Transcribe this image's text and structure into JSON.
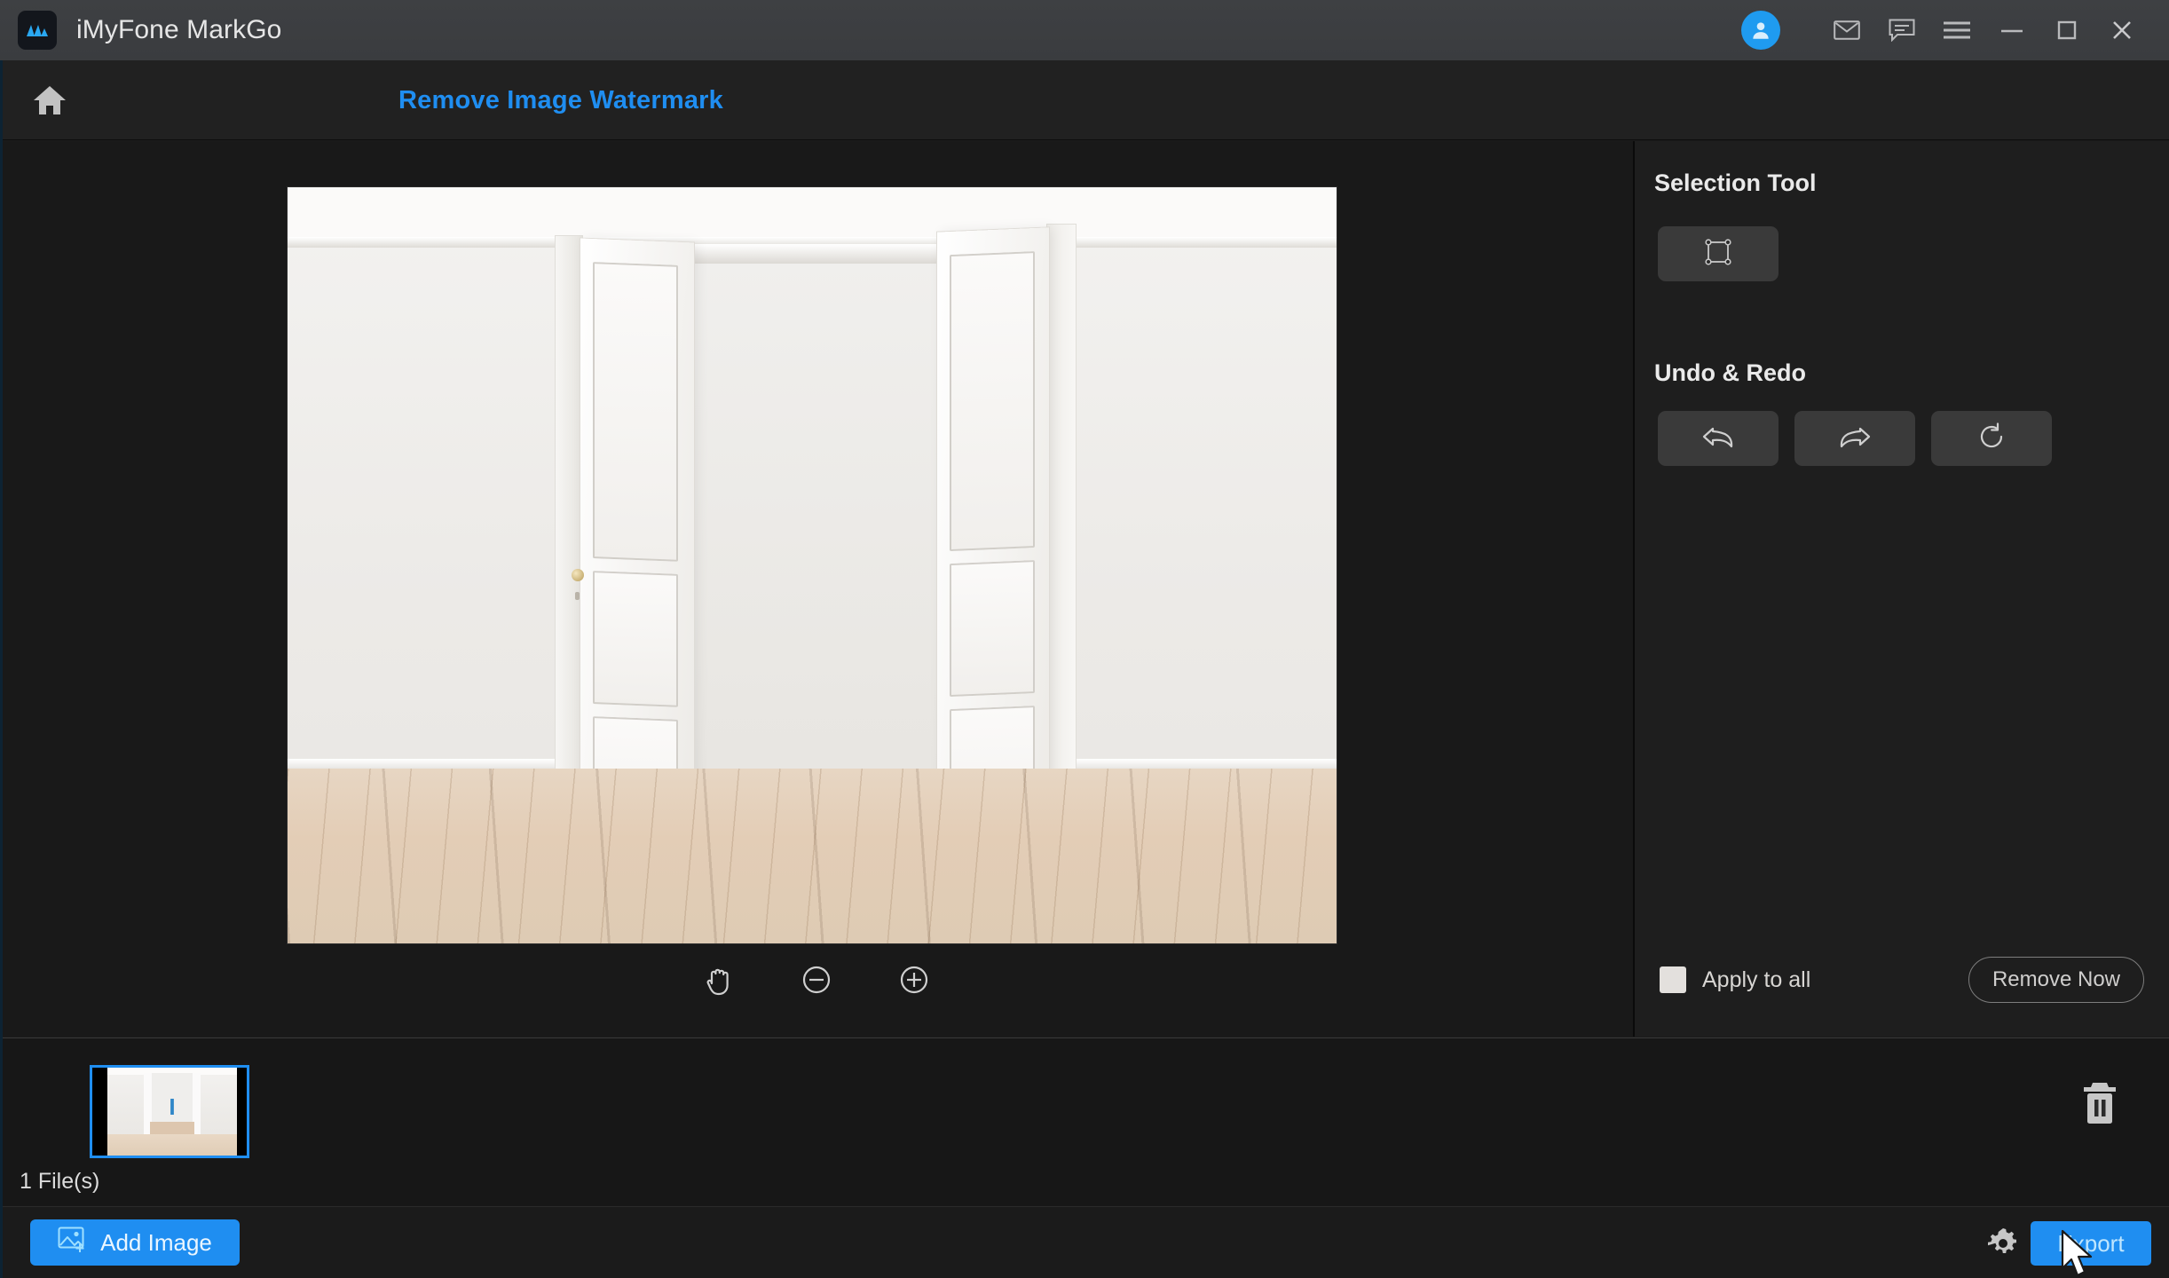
{
  "titlebar": {
    "app_name": "iMyFone MarkGo",
    "logo_icon": "markgo-logo-icon",
    "accent": "#1f9bf0",
    "icons": [
      {
        "name": "account-avatar-icon",
        "glyph": "person"
      },
      {
        "name": "mail-icon",
        "glyph": "envelope"
      },
      {
        "name": "feedback-icon",
        "glyph": "speech-bubble"
      },
      {
        "name": "menu-icon",
        "glyph": "hamburger"
      },
      {
        "name": "minimize-icon",
        "glyph": "dash"
      },
      {
        "name": "maximize-icon",
        "glyph": "square"
      },
      {
        "name": "close-icon",
        "glyph": "cross"
      }
    ]
  },
  "header": {
    "home_icon": "home-icon",
    "title": "Remove Image Watermark",
    "title_color": "#1f8ef1"
  },
  "canvas": {
    "image_description": "Empty white room with open double doors and light wooden floor",
    "zoom_tools": [
      {
        "name": "pan-hand-tool",
        "label": "hand"
      },
      {
        "name": "zoom-out-button",
        "label": "minus-circle"
      },
      {
        "name": "zoom-in-button",
        "label": "plus-circle"
      }
    ]
  },
  "sidebar": {
    "selection_tool": {
      "heading": "Selection Tool",
      "button_icon": "marquee-selection-icon"
    },
    "undo_redo": {
      "heading": "Undo & Redo",
      "buttons": [
        {
          "name": "undo-button",
          "icon": "undo-arrow-icon"
        },
        {
          "name": "redo-button",
          "icon": "redo-arrow-icon"
        },
        {
          "name": "reset-button",
          "icon": "refresh-icon"
        }
      ]
    },
    "apply_to_all_label": "Apply to all",
    "apply_to_all_checked": true,
    "remove_now_label": "Remove Now"
  },
  "filmstrip": {
    "file_count_label": "1 File(s)",
    "thumbnail_selected": true,
    "selection_color": "#1f8ef1",
    "delete_icon": "trash-icon"
  },
  "footer": {
    "add_image_label": "Add Image",
    "add_image_icon": "image-plus-icon",
    "settings_icon": "gear-icon",
    "export_label": "Export",
    "accent": "#1f8ef1",
    "cursor": "mouse-pointer"
  }
}
